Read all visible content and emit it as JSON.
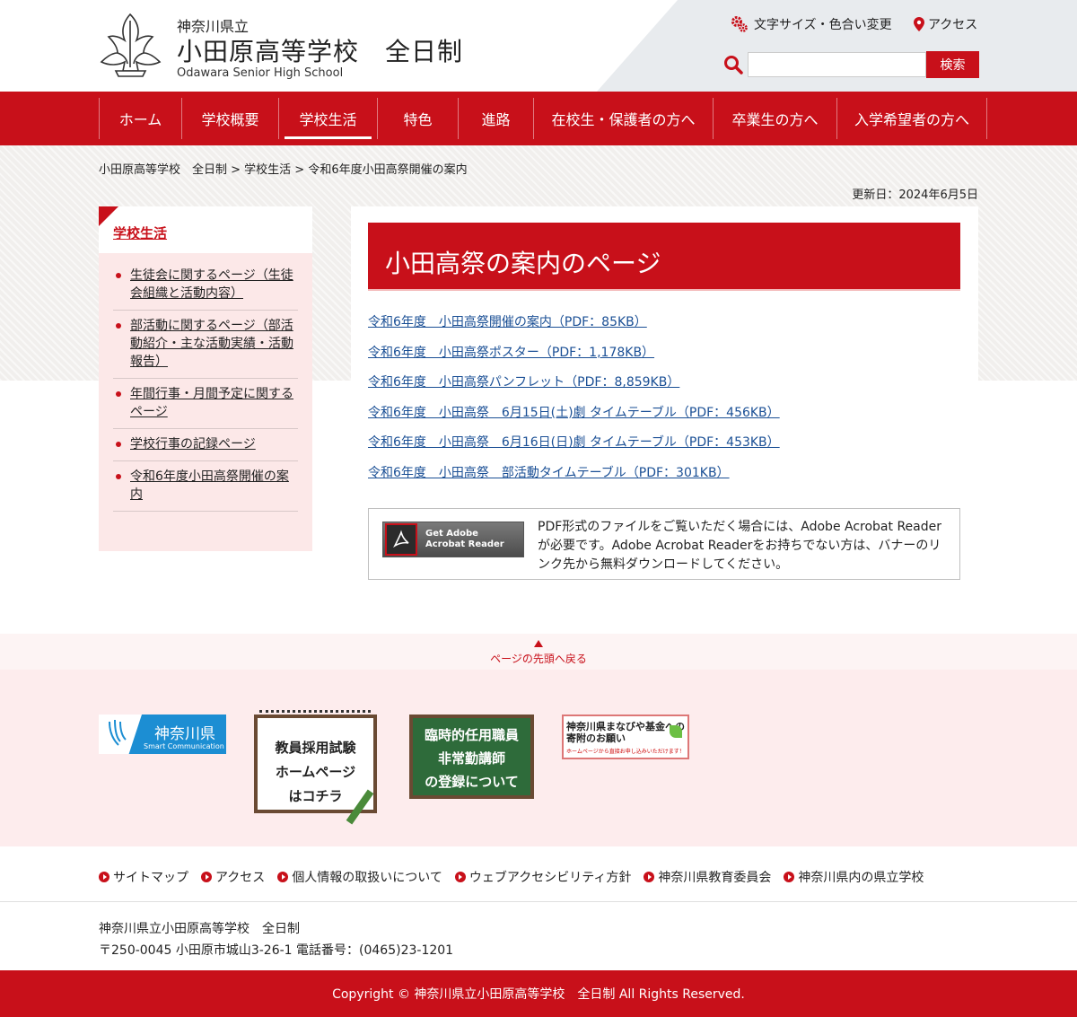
{
  "header": {
    "prefecture": "神奈川県立",
    "school_name": "小田原高等学校　全日制",
    "school_name_en": "Odawara Senior High School",
    "text_size_label": "文字サイズ・色合い変更",
    "access_label": "アクセス",
    "search_placeholder": "",
    "search_button": "検索"
  },
  "nav": [
    {
      "label": "ホーム",
      "active": false
    },
    {
      "label": "学校概要",
      "active": false
    },
    {
      "label": "学校生活",
      "active": true
    },
    {
      "label": "特色",
      "active": false
    },
    {
      "label": "進路",
      "active": false
    },
    {
      "label": "在校生・保護者の方へ",
      "active": false
    },
    {
      "label": "卒業生の方へ",
      "active": false
    },
    {
      "label": "入学希望者の方へ",
      "active": false
    }
  ],
  "breadcrumb": "小田原高等学校　全日制 > 学校生活 > 令和6年度小田高祭開催の案内",
  "updated": "更新日：2024年6月5日",
  "sidebar": {
    "title": "学校生活",
    "items": [
      "生徒会に関するページ（生徒会組織と活動内容）",
      "部活動に関するページ（部活動紹介・主な活動実績・活動報告）",
      "年間行事・月間予定に関するページ",
      "学校行事の記録ページ",
      "令和6年度小田高祭開催の案内"
    ]
  },
  "main": {
    "title": "小田高祭の案内のページ",
    "links": [
      "令和6年度　小田高祭開催の案内（PDF：85KB）",
      "令和6年度　小田高祭ポスター（PDF：1,178KB）",
      "令和6年度　小田高祭パンフレット（PDF：8,859KB）",
      "令和6年度　小田高祭　6月15日(土)劇 タイムテーブル（PDF：456KB）",
      "令和6年度　小田高祭　6月16日(日)劇 タイムテーブル（PDF：453KB）",
      "令和6年度　小田高祭　部活動タイムテーブル（PDF：301KB）"
    ],
    "adobe_line1": "Get Adobe",
    "adobe_line2": "Acrobat Reader",
    "pdf_note": "PDF形式のファイルをご覧いただく場合には、Adobe Acrobat Readerが必要です。Adobe Acrobat Readerをお持ちでない方は、バナーのリンク先から無料ダウンロードしてください。"
  },
  "totop": "ページの先頭へ戻る",
  "banners": {
    "kanagawa_name": "神奈川県",
    "kanagawa_sub": "Smart Communication",
    "teacher_recruit": [
      "教員採用試験",
      "ホームページ",
      "はコチラ"
    ],
    "temp_staff": [
      "臨時的任用職員",
      "非常勤講師",
      "の登録について"
    ],
    "fund_title": "神奈川県まなびや基金への寄附のお願い",
    "fund_sub": "ホームページから直接お申し込みいただけます！"
  },
  "footer": {
    "links": [
      "サイトマップ",
      "アクセス",
      "個人情報の取扱いについて",
      "ウェブアクセシビリティ方針",
      "神奈川県教育委員会",
      "神奈川県内の県立学校"
    ],
    "name": "神奈川県立小田原高等学校　全日制",
    "address": "〒250-0045 小田原市城山3-26-1 電話番号：(0465)23-1201",
    "copyright": "Copyright © 神奈川県立小田原高等学校　全日制 All Rights Reserved."
  },
  "colors": {
    "brand_red": "#c8101a",
    "link_blue": "#1a4f95"
  }
}
